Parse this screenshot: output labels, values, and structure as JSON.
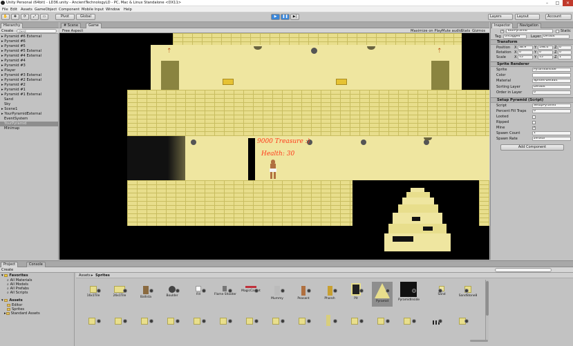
{
  "window": {
    "title": "Unity Personal (64bit) - LD36.unity - AncientTechnologyLD - PC, Mac & Linux Standalone <DX11>"
  },
  "menu": [
    "File",
    "Edit",
    "Assets",
    "GameObject",
    "Component",
    "Mobile Input",
    "Window",
    "Help"
  ],
  "toolbar": {
    "pivot": "Pivot",
    "global": "Global",
    "layers": "Layers",
    "layout": "Layout",
    "account": "Account"
  },
  "hierarchy": {
    "tab": "Hierarchy",
    "create": "Create",
    "search_placeholder": "Q▾All",
    "items": [
      {
        "label": "▸ Pyramid #6 External"
      },
      {
        "label": "▸ Pyramid #6"
      },
      {
        "label": "▸ Pyramid #5"
      },
      {
        "label": "▸ Pyramid #5 External"
      },
      {
        "label": "▸ Pyramid #4 External"
      },
      {
        "label": "▸ Pyramid #4"
      },
      {
        "label": "▸ Pyramid #3"
      },
      {
        "label": "▸ Player"
      },
      {
        "label": "▸ Pyramid #3 External"
      },
      {
        "label": "▸ Pyramid #2 External"
      },
      {
        "label": "▸ Pyramid #2"
      },
      {
        "label": "▸ Pyramid #1"
      },
      {
        "label": "▸ Pyramid #1 External"
      },
      {
        "label": "Sand"
      },
      {
        "label": "Sky"
      },
      {
        "label": "▸ Scene1"
      },
      {
        "label": "▸ YourPyramidExternal"
      },
      {
        "label": "EventSystem"
      },
      {
        "label": "YourPyramid"
      },
      {
        "label": "Minimap"
      }
    ],
    "selected_index": 18
  },
  "scene_tabs": [
    {
      "label": "# Scene"
    },
    {
      "label": "Game"
    }
  ],
  "game_bar": {
    "aspect": "Free Aspect",
    "maximize": "Maximize on Play",
    "mute": "Mute audio",
    "stats": "Stats",
    "gizmos": "Gizmos"
  },
  "game": {
    "money": "9000 Treasure :)",
    "health": "Health: 30"
  },
  "inspector": {
    "tabs": [
      {
        "label": "Inspector"
      },
      {
        "label": "Navigation"
      }
    ],
    "object_name": "YourPyramid",
    "static_label": "Static",
    "tag_label": "Tag",
    "tag_value": "Untagged",
    "layer_label": "Layer",
    "layer_value": "Default",
    "transform": {
      "title": "Transform",
      "position": {
        "label": "Position",
        "x": "38.9",
        "y": "198.4",
        "z": "0"
      },
      "rotation": {
        "label": "Rotation",
        "x": "0",
        "y": "0",
        "z": "0"
      },
      "scale": {
        "label": "Scale",
        "x": "15",
        "y": "15",
        "z": "1"
      }
    },
    "sprite_renderer": {
      "title": "Sprite Renderer",
      "sprite_label": "Sprite",
      "sprite_value": "PyramidInside",
      "color_label": "Color",
      "material_label": "Material",
      "material_value": "Sprites-Default",
      "sorting_label": "Sorting Layer",
      "sorting_value": "Default",
      "order_label": "Order in Layer",
      "order_value": "0"
    },
    "setup": {
      "title": "Setup Pyramid (Script)",
      "script_label": "Script",
      "script_value": "SetupPyramid",
      "fill_label": "Percent Fill Traps",
      "fill_value": "0",
      "looted_label": "Looted",
      "ripped_label": "Ripped",
      "mine_label": "Mine",
      "spawn_count_label": "Spawn Count",
      "spawn_count_value": "1",
      "spawn_rate_label": "Spawn Rate",
      "spawn_rate_value": "29.643"
    },
    "add_component": "Add Component"
  },
  "project": {
    "tabs": [
      {
        "label": "Project"
      },
      {
        "label": "Console"
      }
    ],
    "create": "Create",
    "favorites": {
      "title": "Favorites",
      "items": [
        "All Materials",
        "All Models",
        "All Prefabs",
        "All Scripts"
      ]
    },
    "assets": {
      "title": "Assets",
      "items": [
        "Editor",
        "Sprites",
        "Standard Assets"
      ]
    },
    "breadcrumb": [
      "Assets",
      "Sprites"
    ],
    "row1": [
      {
        "name": "16x1Tile"
      },
      {
        "name": "26x1Tile"
      },
      {
        "name": "Ballista"
      },
      {
        "name": "Boulder"
      },
      {
        "name": "Fill"
      },
      {
        "name": "Flame Shooter"
      },
      {
        "name": "MagicCarpet"
      },
      {
        "name": "Mummy"
      },
      {
        "name": "Peasant"
      },
      {
        "name": "Pharoh"
      },
      {
        "name": "Pit"
      },
      {
        "name": "Pyramid"
      },
      {
        "name": "PyramidInside"
      },
      {
        "name": "Sand"
      },
      {
        "name": "SandStone8"
      }
    ]
  },
  "colors": {
    "sand": "#efe6a0",
    "brick_line": "#c8bd60",
    "text_red": "#ff3a1a",
    "selection": "#8e8e8e"
  }
}
